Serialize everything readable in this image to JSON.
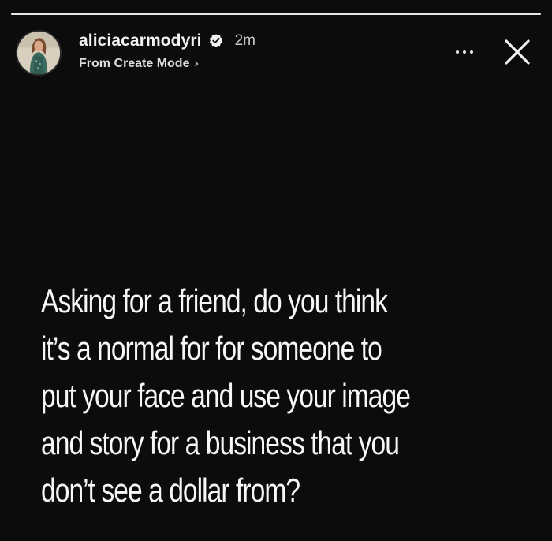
{
  "story": {
    "progress_segments": 1,
    "header": {
      "username": "aliciacarmodyri",
      "verified": true,
      "time": "2m",
      "subtitle": "From Create Mode",
      "chevron": "›",
      "more_icon": "more-horizontal-icon",
      "close_icon": "close-icon"
    },
    "caption_lines": [
      "Asking for a friend, do you think",
      "it’s a normal for for someone to",
      "put your face and use your image",
      "and story for a business that you",
      "don’t see a dollar from?"
    ]
  },
  "colors": {
    "background": "#0c0c0c",
    "text": "#f7f7f7",
    "progress_active": "#e8e8e8"
  }
}
